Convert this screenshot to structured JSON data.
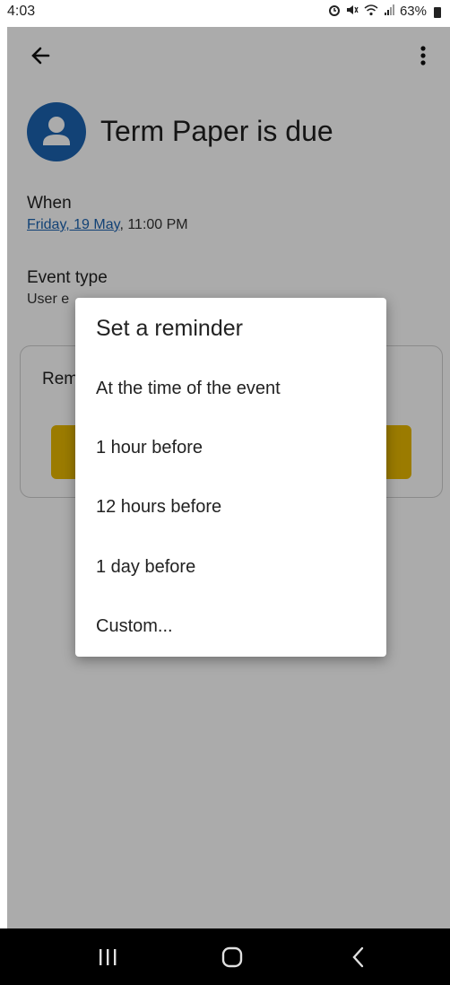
{
  "status_bar": {
    "time": "4:03",
    "battery": "63%",
    "icons": [
      "alarm-icon",
      "mute-icon",
      "wifi-icon",
      "signal-icon",
      "battery-icon"
    ]
  },
  "toolbar": {
    "back_icon": "back-arrow-icon",
    "more_icon": "more-vert-icon"
  },
  "event": {
    "title": "Term Paper is due",
    "avatar_icon": "person-icon",
    "avatar_color": "#1c63b0"
  },
  "when": {
    "label": "When",
    "date_link": "Friday, 19 May",
    "time": ", 11:00 PM"
  },
  "event_type": {
    "label": "Event type",
    "value_visible": "User e"
  },
  "reminder_card": {
    "label_visible": "Rem",
    "button_color": "#e8b800"
  },
  "dialog": {
    "title": "Set a reminder",
    "options": [
      "At the time of the event",
      "1 hour before",
      "12 hours before",
      "1 day before",
      "Custom..."
    ]
  },
  "nav_bar": {
    "icons": [
      "recents-icon",
      "home-icon",
      "back-icon"
    ]
  }
}
